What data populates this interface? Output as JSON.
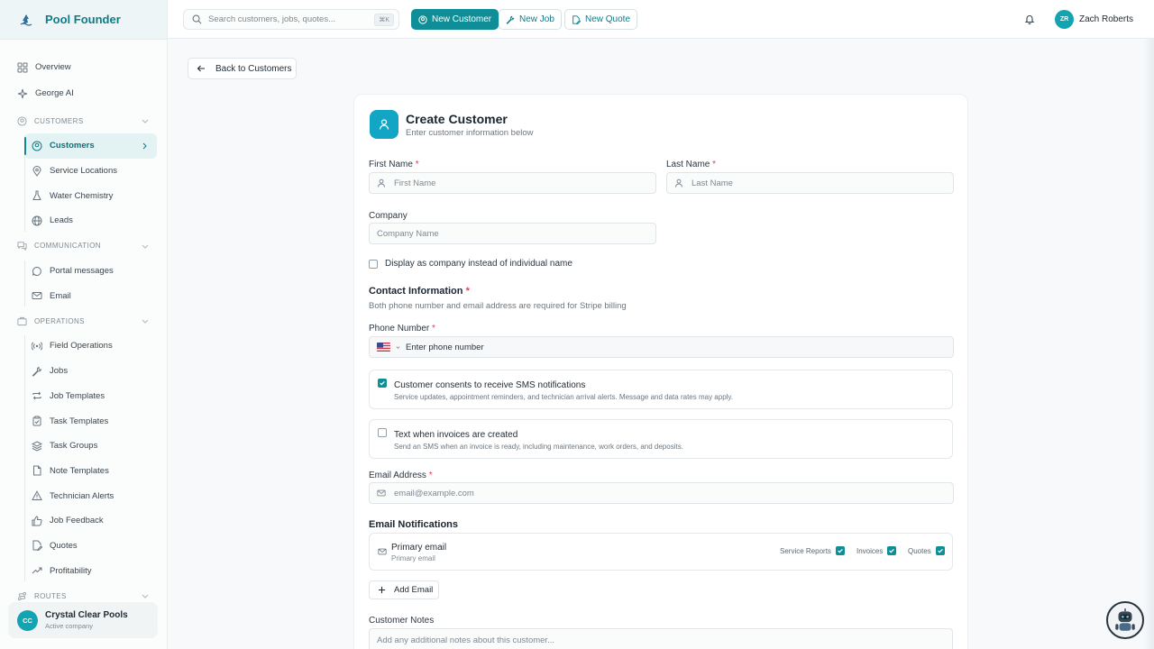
{
  "brand": {
    "name": "Pool Founder"
  },
  "sidebar": {
    "top_items": [
      {
        "label": "Overview",
        "icon": "grid-icon"
      },
      {
        "label": "George AI",
        "icon": "sparkle-icon"
      }
    ],
    "sections": [
      {
        "title": "CUSTOMERS",
        "items": [
          {
            "label": "Customers",
            "active": true
          },
          {
            "label": "Service Locations"
          },
          {
            "label": "Water Chemistry"
          },
          {
            "label": "Leads"
          }
        ]
      },
      {
        "title": "COMMUNICATION",
        "items": [
          {
            "label": "Portal messages"
          },
          {
            "label": "Email"
          }
        ]
      },
      {
        "title": "OPERATIONS",
        "items": [
          {
            "label": "Field Operations"
          },
          {
            "label": "Jobs"
          },
          {
            "label": "Job Templates"
          },
          {
            "label": "Task Templates"
          },
          {
            "label": "Task Groups"
          },
          {
            "label": "Note Templates"
          },
          {
            "label": "Technician Alerts"
          },
          {
            "label": "Job Feedback"
          },
          {
            "label": "Quotes"
          },
          {
            "label": "Profitability"
          }
        ]
      },
      {
        "title": "ROUTES",
        "items": []
      }
    ],
    "company": {
      "initials": "CC",
      "name": "Crystal Clear Pools",
      "status": "Active company"
    }
  },
  "topbar": {
    "search_placeholder": "Search customers, jobs, quotes...",
    "search_shortcut": "⌘K",
    "new_customer": "New Customer",
    "new_job": "New Job",
    "new_quote": "New Quote",
    "user_initials": "ZR",
    "user_name": "Zach Roberts"
  },
  "back_label": "Back to Customers",
  "form": {
    "title": "Create Customer",
    "subtitle": "Enter customer information below",
    "first_name_label": "First Name",
    "first_name_placeholder": "First Name",
    "last_name_label": "Last Name",
    "last_name_placeholder": "Last Name",
    "company_label": "Company",
    "company_placeholder": "Company Name",
    "display_company_label": "Display as company instead of individual name",
    "display_company_checked": false,
    "contact_title": "Contact Information",
    "contact_desc": "Both phone number and email address are required for Stripe billing",
    "phone_label": "Phone Number",
    "phone_placeholder": "Enter phone number",
    "sms_consent_title": "Customer consents to receive SMS notifications",
    "sms_consent_desc": "Service updates, appointment reminders, and technician arrival alerts. Message and data rates may apply.",
    "sms_consent_checked": true,
    "invoice_text_title": "Text when invoices are created",
    "invoice_text_desc": "Send an SMS when an invoice is ready, including maintenance, work orders, and deposits.",
    "invoice_text_checked": false,
    "email_label": "Email Address",
    "email_placeholder": "email@example.com",
    "email_notif_title": "Email Notifications",
    "primary_email_title": "Primary email",
    "primary_email_sub": "Primary email",
    "pref_service_reports": "Service Reports",
    "pref_invoices": "Invoices",
    "pref_quotes": "Quotes",
    "add_email": "Add Email",
    "notes_label": "Customer Notes",
    "notes_placeholder": "Add any additional notes about this customer..."
  },
  "colors": {
    "accent": "#0f8e98",
    "brand_text": "#0e7c86",
    "required": "#e0405a",
    "icon_tile": "#13a6c4"
  }
}
